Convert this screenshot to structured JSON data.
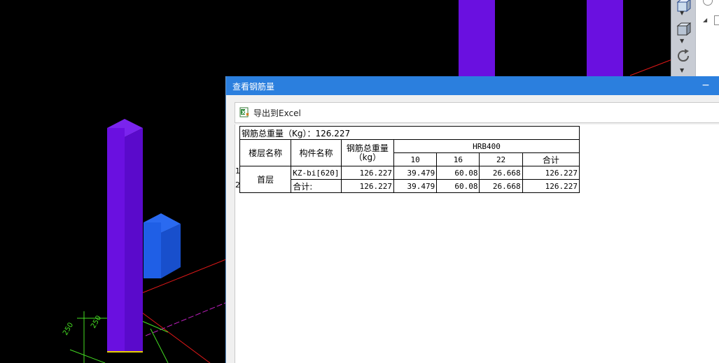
{
  "dialog": {
    "title": "查看钢筋量",
    "minimize_glyph": "−",
    "export_label": "导出到Excel",
    "export_icon": "excel-icon"
  },
  "table": {
    "summary_label": "钢筋总重量（Kg）：126.227",
    "headers": {
      "floor": "楼层名称",
      "component": "构件名称",
      "total_weight": "钢筋总重量（kg）",
      "grade": "HRB400",
      "diameters": [
        "10",
        "16",
        "22",
        "合计"
      ]
    },
    "row_numbers": [
      "1",
      "2"
    ],
    "floor_name": "首层",
    "rows": [
      {
        "component": "KZ-bi[620]",
        "total": "126.227",
        "d10": "39.479",
        "d16": "60.08",
        "d22": "26.668",
        "sum": "126.227"
      },
      {
        "component": "合计:",
        "total": "126.227",
        "d10": "39.479",
        "d16": "60.08",
        "d22": "26.668",
        "sum": "126.227"
      }
    ]
  },
  "viewport": {
    "dim_labels": [
      "250",
      "250"
    ],
    "colors": {
      "column": "#6a10e0",
      "column_dark": "#4f06b8",
      "block": "#1f5fe6",
      "axis_red": "#e01818",
      "axis_magenta": "#c020c0",
      "dim_green": "#44dd22"
    }
  },
  "right_toolbar": {
    "icons": [
      "cube-outline-icon",
      "cube-solid-icon",
      "rotate-icon"
    ]
  }
}
